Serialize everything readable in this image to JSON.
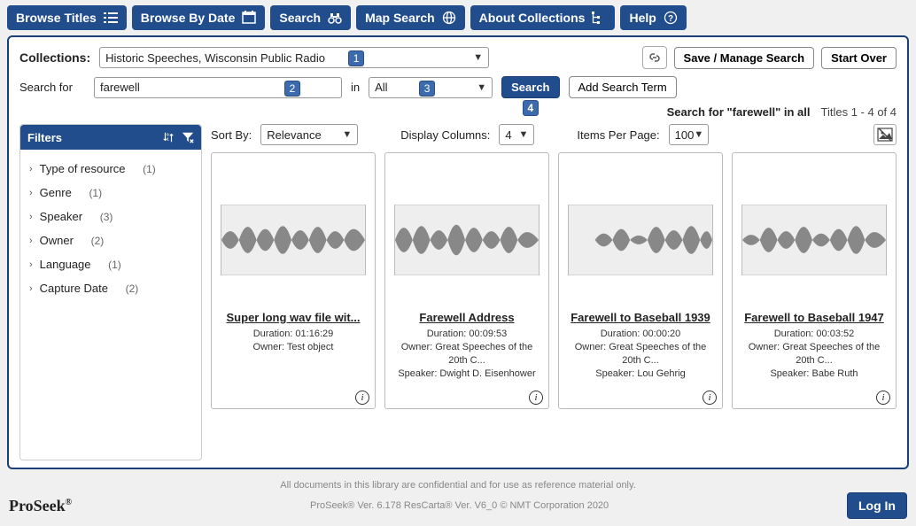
{
  "nav": {
    "browse_titles": "Browse Titles",
    "browse_by_date": "Browse By Date",
    "search": "Search",
    "map_search": "Map Search",
    "about": "About Collections",
    "help": "Help"
  },
  "search": {
    "collections_label": "Collections:",
    "collections_value": "Historic Speeches, Wisconsin Public Radio",
    "search_for_label": "Search for",
    "search_for_value": "farewell",
    "in_label": "in",
    "in_value": "All",
    "search_btn": "Search",
    "add_term_btn": "Add Search Term",
    "save_manage_btn": "Save / Manage Search",
    "start_over_btn": "Start Over"
  },
  "hints": {
    "b1": "1",
    "b2": "2",
    "b3": "3",
    "b4": "4"
  },
  "status": {
    "summary": "Search for \"farewell\" in all",
    "range": "Titles 1 - 4 of 4"
  },
  "filters": {
    "title": "Filters",
    "facets": [
      {
        "label": "Type of resource",
        "count": "(1)"
      },
      {
        "label": "Genre",
        "count": "(1)"
      },
      {
        "label": "Speaker",
        "count": "(3)"
      },
      {
        "label": "Owner",
        "count": "(2)"
      },
      {
        "label": "Language",
        "count": "(1)"
      },
      {
        "label": "Capture Date",
        "count": "(2)"
      }
    ]
  },
  "toolbar": {
    "sort_label": "Sort By:",
    "sort_value": "Relevance",
    "cols_label": "Display Columns:",
    "cols_value": "4",
    "ipp_label": "Items Per Page:",
    "ipp_value": "100"
  },
  "results": [
    {
      "title": "Super long wav file wit...",
      "duration": "Duration: 01:16:29",
      "owner": "Owner: Test object",
      "speaker": ""
    },
    {
      "title": "Farewell Address",
      "duration": "Duration: 00:09:53",
      "owner": "Owner: Great Speeches of the 20th C...",
      "speaker": "Speaker: Dwight D. Eisenhower"
    },
    {
      "title": "Farewell to Baseball 1939",
      "duration": "Duration: 00:00:20",
      "owner": "Owner: Great Speeches of the 20th C...",
      "speaker": "Speaker: Lou Gehrig"
    },
    {
      "title": "Farewell to Baseball 1947",
      "duration": "Duration: 00:03:52",
      "owner": "Owner: Great Speeches of the 20th C...",
      "speaker": "Speaker: Babe Ruth"
    }
  ],
  "footer": {
    "disclaimer": "All documents in this library are confidential and for use as reference material only.",
    "brand": "ProSeek",
    "version": "ProSeek® Ver. 6.178  ResCarta® Ver. V6_0 © NMT Corporation 2020",
    "login": "Log In"
  }
}
